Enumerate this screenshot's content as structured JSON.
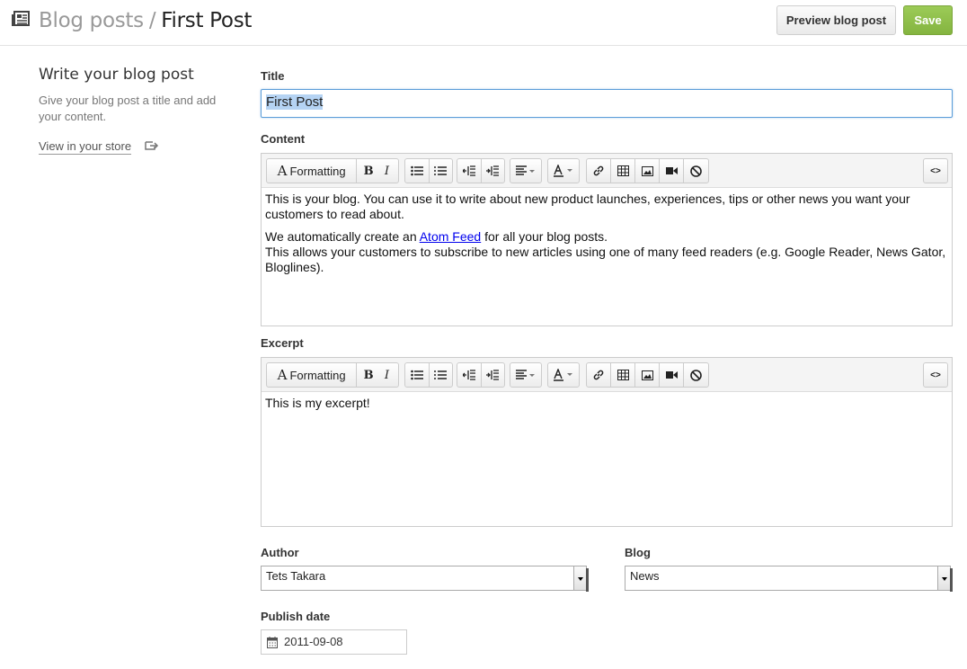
{
  "header": {
    "breadcrumb_parent": "Blog posts",
    "breadcrumb_separator": "/",
    "breadcrumb_current": "First Post",
    "preview_label": "Preview blog post",
    "save_label": "Save"
  },
  "sidebar": {
    "title": "Write your blog post",
    "description": "Give your blog post a title and add your content.",
    "store_link": "View in your store"
  },
  "form": {
    "title_label": "Title",
    "title_value": "First Post",
    "content_label": "Content",
    "content": {
      "para1": "This is your blog. You can use it to write about new product launches, experiences, tips or other news you want your customers to read about.",
      "para2_before": "We automatically create an ",
      "para2_link": "Atom Feed",
      "para2_after": " for all your blog posts.",
      "para2_line2": "This allows your customers to subscribe to new articles using one of many feed readers (e.g. Google Reader, News Gator, Bloglines)."
    },
    "excerpt_label": "Excerpt",
    "excerpt_text": "This is my excerpt!",
    "author_label": "Author",
    "author_value": "Tets Takara",
    "blog_label": "Blog",
    "blog_value": "News",
    "publish_label": "Publish date",
    "publish_value": "2011-09-08"
  },
  "toolbar": {
    "formatting_label": "Formatting",
    "bold_label": "B",
    "italic_label": "I",
    "html_label": "<>"
  },
  "colors": {
    "save_green": "#8cbf48",
    "focus_blue": "#5b9dd9",
    "link_blue": "#0000ee"
  }
}
